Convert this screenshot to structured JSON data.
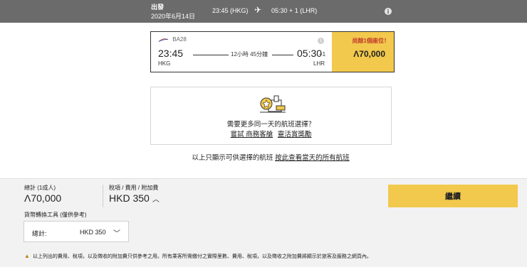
{
  "header": {
    "departure_label": "出發",
    "departure_date": "2020年6月14日",
    "segment_from": "23:45 (HKG)",
    "segment_to": "05:30 + 1 (LHR)"
  },
  "flight": {
    "airline_code": "BA28",
    "dep_time": "23:45",
    "dep_airport": "HKG",
    "duration": "12小時 45分鐘",
    "arr_time": "05:30",
    "arr_day_offset": "+1",
    "arr_airport": "LHR",
    "seats_left": "尚餘1個座位！",
    "price": "Λ70,000"
  },
  "suggestion": {
    "question": "需要更多同一天的航班選擇？",
    "link_business": "嘗試 商務客艙",
    "link_flexible": "靈活賞獎勵"
  },
  "shown_note": {
    "text": "以上只顯示可供選擇的航班",
    "link": "按此查看當天的所有航班"
  },
  "summary": {
    "total_label": "總計 (1成人)",
    "total_amount": "Λ70,000",
    "tax_label": "稅項 / 費用 / 附加費",
    "tax_amount": "HKD 350",
    "continue_label": "繼續",
    "converter_label": "貨幣轉換工具 (僅供參考)",
    "converter_key": "總計:",
    "converter_value": "HKD 350",
    "disclaimer": "以上列出的費用、稅項，以及徵收的附加費只供參考之用。所有乘客所需繳付之實際里數、費用、稅項，以及徵收之附加費將顯示於旅客及服務之網頁內。"
  },
  "colors": {
    "header_bg": "#6b6b6b",
    "accent_yellow": "#f2c94c",
    "seats_red": "#c0392b"
  },
  "icons": [
    "plane-icon",
    "info-icon",
    "british-airways-logo",
    "award-illustration",
    "caret-up-icon",
    "chevron-down-icon",
    "warning-icon"
  ]
}
